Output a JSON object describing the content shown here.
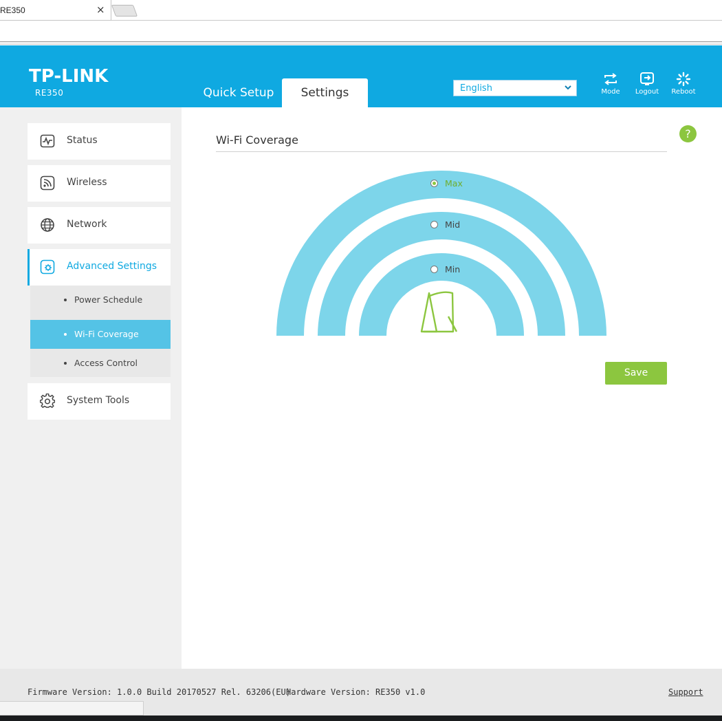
{
  "browser": {
    "tab_title": "RE350",
    "tab_close": "×"
  },
  "header": {
    "brand": "TP-LINK",
    "model": "RE350",
    "tabs": [
      {
        "label": "Quick Setup",
        "active": false
      },
      {
        "label": "Settings",
        "active": true
      }
    ],
    "language": {
      "selected": "English",
      "icon": "chevron-down-icon"
    },
    "buttons": [
      {
        "label": "Mode",
        "icon": "mode-icon"
      },
      {
        "label": "Logout",
        "icon": "logout-icon"
      },
      {
        "label": "Reboot",
        "icon": "reboot-icon"
      }
    ]
  },
  "sidebar": {
    "items": [
      {
        "label": "Status",
        "icon": "status-icon"
      },
      {
        "label": "Wireless",
        "icon": "wireless-icon"
      },
      {
        "label": "Network",
        "icon": "network-icon"
      },
      {
        "label": "Advanced Settings",
        "icon": "advanced-settings-icon",
        "active": true
      },
      {
        "label": "System Tools",
        "icon": "system-tools-icon"
      }
    ],
    "submenu": [
      {
        "label": "Power Schedule",
        "active": false
      },
      {
        "label": "Wi-Fi Coverage",
        "active": true
      },
      {
        "label": "Access Control",
        "active": false
      }
    ]
  },
  "main": {
    "title": "Wi-Fi Coverage",
    "help": "?",
    "coverage_options": [
      {
        "label": "Max",
        "checked": true
      },
      {
        "label": "Mid",
        "checked": false
      },
      {
        "label": "Min",
        "checked": false
      }
    ],
    "save_label": "Save"
  },
  "footer": {
    "firmware": "Firmware Version: 1.0.0 Build 20170527 Rel. 63206(EU)",
    "hardware": "Hardware Version: RE350 v1.0",
    "support": "Support"
  },
  "colors": {
    "header": "#0fa9e1",
    "arc": "#7dd5ea",
    "accent_green": "#8cc63f",
    "submenu_active": "#54c3e6"
  }
}
